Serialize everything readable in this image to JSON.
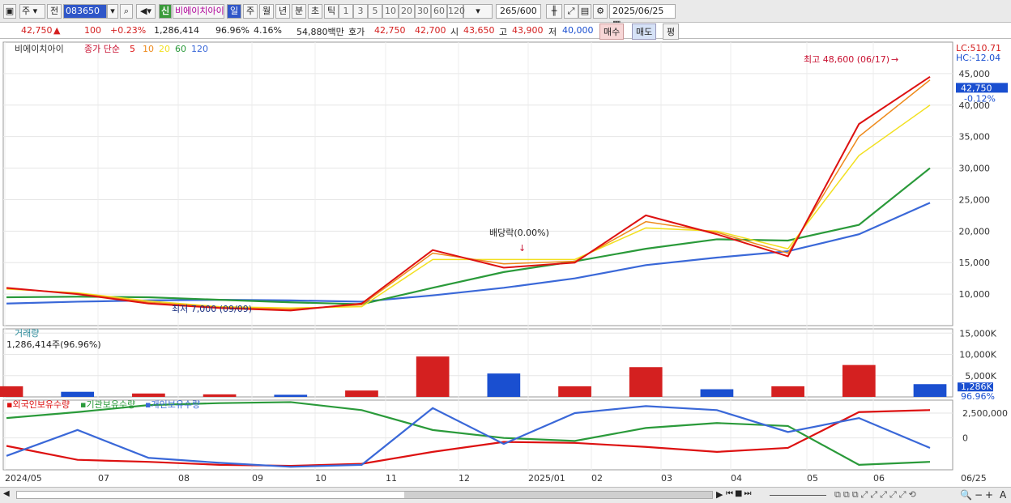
{
  "toolbar": {
    "market": "주",
    "prev_label": "전",
    "code": "083650",
    "credit_badge": "신",
    "stock_name": "비에이치아이",
    "periods": [
      "일",
      "주",
      "월",
      "년",
      "분",
      "초",
      "틱"
    ],
    "intervals": [
      "1",
      "3",
      "5",
      "10",
      "20",
      "30",
      "60",
      "120"
    ],
    "count": "265",
    "count_total": "/600",
    "date": "2025/06/25"
  },
  "quote": {
    "price": "42,750",
    "change": "100",
    "change_pct": "+0.23%",
    "volume": "1,286,414",
    "vol_ratio": "96.96%",
    "turnover": "4.16%",
    "amount": "54,880백만",
    "ask_label": "호가",
    "ask": "42,750",
    "bid": "42,700",
    "open_label": "시",
    "open": "43,650",
    "high_label": "고",
    "high": "43,900",
    "low_label": "저",
    "low": "40,000",
    "buy_btn": "매수",
    "sell_btn": "매도",
    "eval_btn": "평"
  },
  "colors": {
    "up": "#d42020",
    "down": "#1a4fd0",
    "ma5": "#dd1111",
    "ma10": "#ee8a1c",
    "ma20": "#f2e020",
    "ma60": "#2a9a3a",
    "ma120": "#3a68d8"
  },
  "chart_data": [
    {
      "type": "line",
      "panel": "price",
      "title_name": "비에이치아이",
      "ma_label": "종가 단순",
      "ma_periods": [
        "5",
        "10",
        "20",
        "60",
        "120"
      ],
      "lc_label": "LC:510.71",
      "hc_label": "HC:-12.04",
      "current_price": "42,750",
      "current_pct": "-0.12%",
      "ylim": [
        5000,
        50000
      ],
      "y_ticks": [
        10000,
        15000,
        20000,
        25000,
        30000,
        35000,
        40000,
        45000
      ],
      "y_tick_labels": [
        "10,000",
        "15,000",
        "20,000",
        "25,000",
        "30,000",
        "35,000",
        "40,000",
        "45,000"
      ],
      "x_ticks": [
        "2024/05",
        "07",
        "08",
        "09",
        "10",
        "11",
        "12",
        "2025/01",
        "02",
        "03",
        "04",
        "05",
        "06",
        "06/25"
      ],
      "annotations": {
        "high": "최고 48,600 (06/17)",
        "low": "최저 7,000 (09/09)",
        "dividend": "배당락(0.00%)"
      },
      "x": [
        "2024/05",
        "2024/06",
        "2024/07",
        "2024/08",
        "2024/09",
        "2024/10",
        "2024/11",
        "2024/12",
        "2025/01",
        "2025/02",
        "2025/03",
        "2025/04",
        "2025/05",
        "2025/06"
      ],
      "series": [
        {
          "name": "5",
          "values": [
            11000,
            10000,
            8500,
            7800,
            7400,
            8500,
            17000,
            14200,
            15000,
            22500,
            19500,
            16000,
            37000,
            44500
          ]
        },
        {
          "name": "10",
          "values": [
            10900,
            10100,
            8700,
            7900,
            7600,
            8300,
            16500,
            14800,
            15200,
            21500,
            19800,
            16500,
            35000,
            44000
          ]
        },
        {
          "name": "20",
          "values": [
            10800,
            10200,
            8900,
            8000,
            7800,
            8000,
            15500,
            15500,
            15500,
            20500,
            20000,
            17200,
            32000,
            40000
          ]
        },
        {
          "name": "60",
          "values": [
            9500,
            9600,
            9500,
            9100,
            8700,
            8400,
            11000,
            13500,
            15200,
            17200,
            18700,
            18500,
            21000,
            30000
          ]
        },
        {
          "name": "120",
          "values": [
            8500,
            8800,
            9000,
            9100,
            9000,
            8800,
            9800,
            11000,
            12500,
            14600,
            15800,
            16800,
            19500,
            24500
          ]
        }
      ]
    },
    {
      "type": "bar",
      "panel": "volume",
      "name": "거래량",
      "current": "1,286,414주(96.96%)",
      "current_label": "1,286K",
      "current_pct": "96.96%",
      "y_ticks": [
        5000,
        10000,
        15000
      ],
      "y_tick_labels": [
        "5,000K",
        "10,000K",
        "15,000K"
      ],
      "categories": [
        "2024/05",
        "2024/06",
        "2024/07",
        "2024/08",
        "2024/09",
        "2024/10",
        "2024/11",
        "2024/12",
        "2025/01",
        "2025/02",
        "2025/03",
        "2025/04",
        "2025/05",
        "2025/06"
      ],
      "values": [
        2500,
        1200,
        800,
        600,
        500,
        1500,
        9500,
        5500,
        2500,
        7000,
        1800,
        2500,
        7500,
        3000
      ]
    },
    {
      "type": "line",
      "panel": "holdings",
      "series_labels": [
        "외국인보유수량",
        "기관보유수량",
        "개인보유수량"
      ],
      "y_ticks": [
        0,
        2500000
      ],
      "y_tick_labels": [
        "0",
        "2,500,000"
      ],
      "x": [
        "2024/05",
        "2024/06",
        "2024/07",
        "2024/08",
        "2024/09",
        "2024/10",
        "2024/11",
        "2024/12",
        "2025/01",
        "2025/02",
        "2025/03",
        "2025/04",
        "2025/05",
        "2025/06"
      ],
      "series": [
        {
          "name": "외국인보유수량",
          "values": [
            -800000,
            -2200000,
            -2400000,
            -2700000,
            -2800000,
            -2600000,
            -1400000,
            -400000,
            -500000,
            -900000,
            -1400000,
            -1000000,
            2600000,
            2800000
          ]
        },
        {
          "name": "기관보유수량",
          "values": [
            2000000,
            2600000,
            3300000,
            3500000,
            3600000,
            2800000,
            800000,
            0,
            -300000,
            1000000,
            1500000,
            1200000,
            -2700000,
            -2400000
          ]
        },
        {
          "name": "개인보유수량",
          "values": [
            -1800000,
            800000,
            -2000000,
            -2500000,
            -2900000,
            -2700000,
            3000000,
            -600000,
            2500000,
            3200000,
            2800000,
            600000,
            2000000,
            -1000000
          ]
        }
      ]
    }
  ],
  "bottom": {
    "zoom_label": "A"
  }
}
